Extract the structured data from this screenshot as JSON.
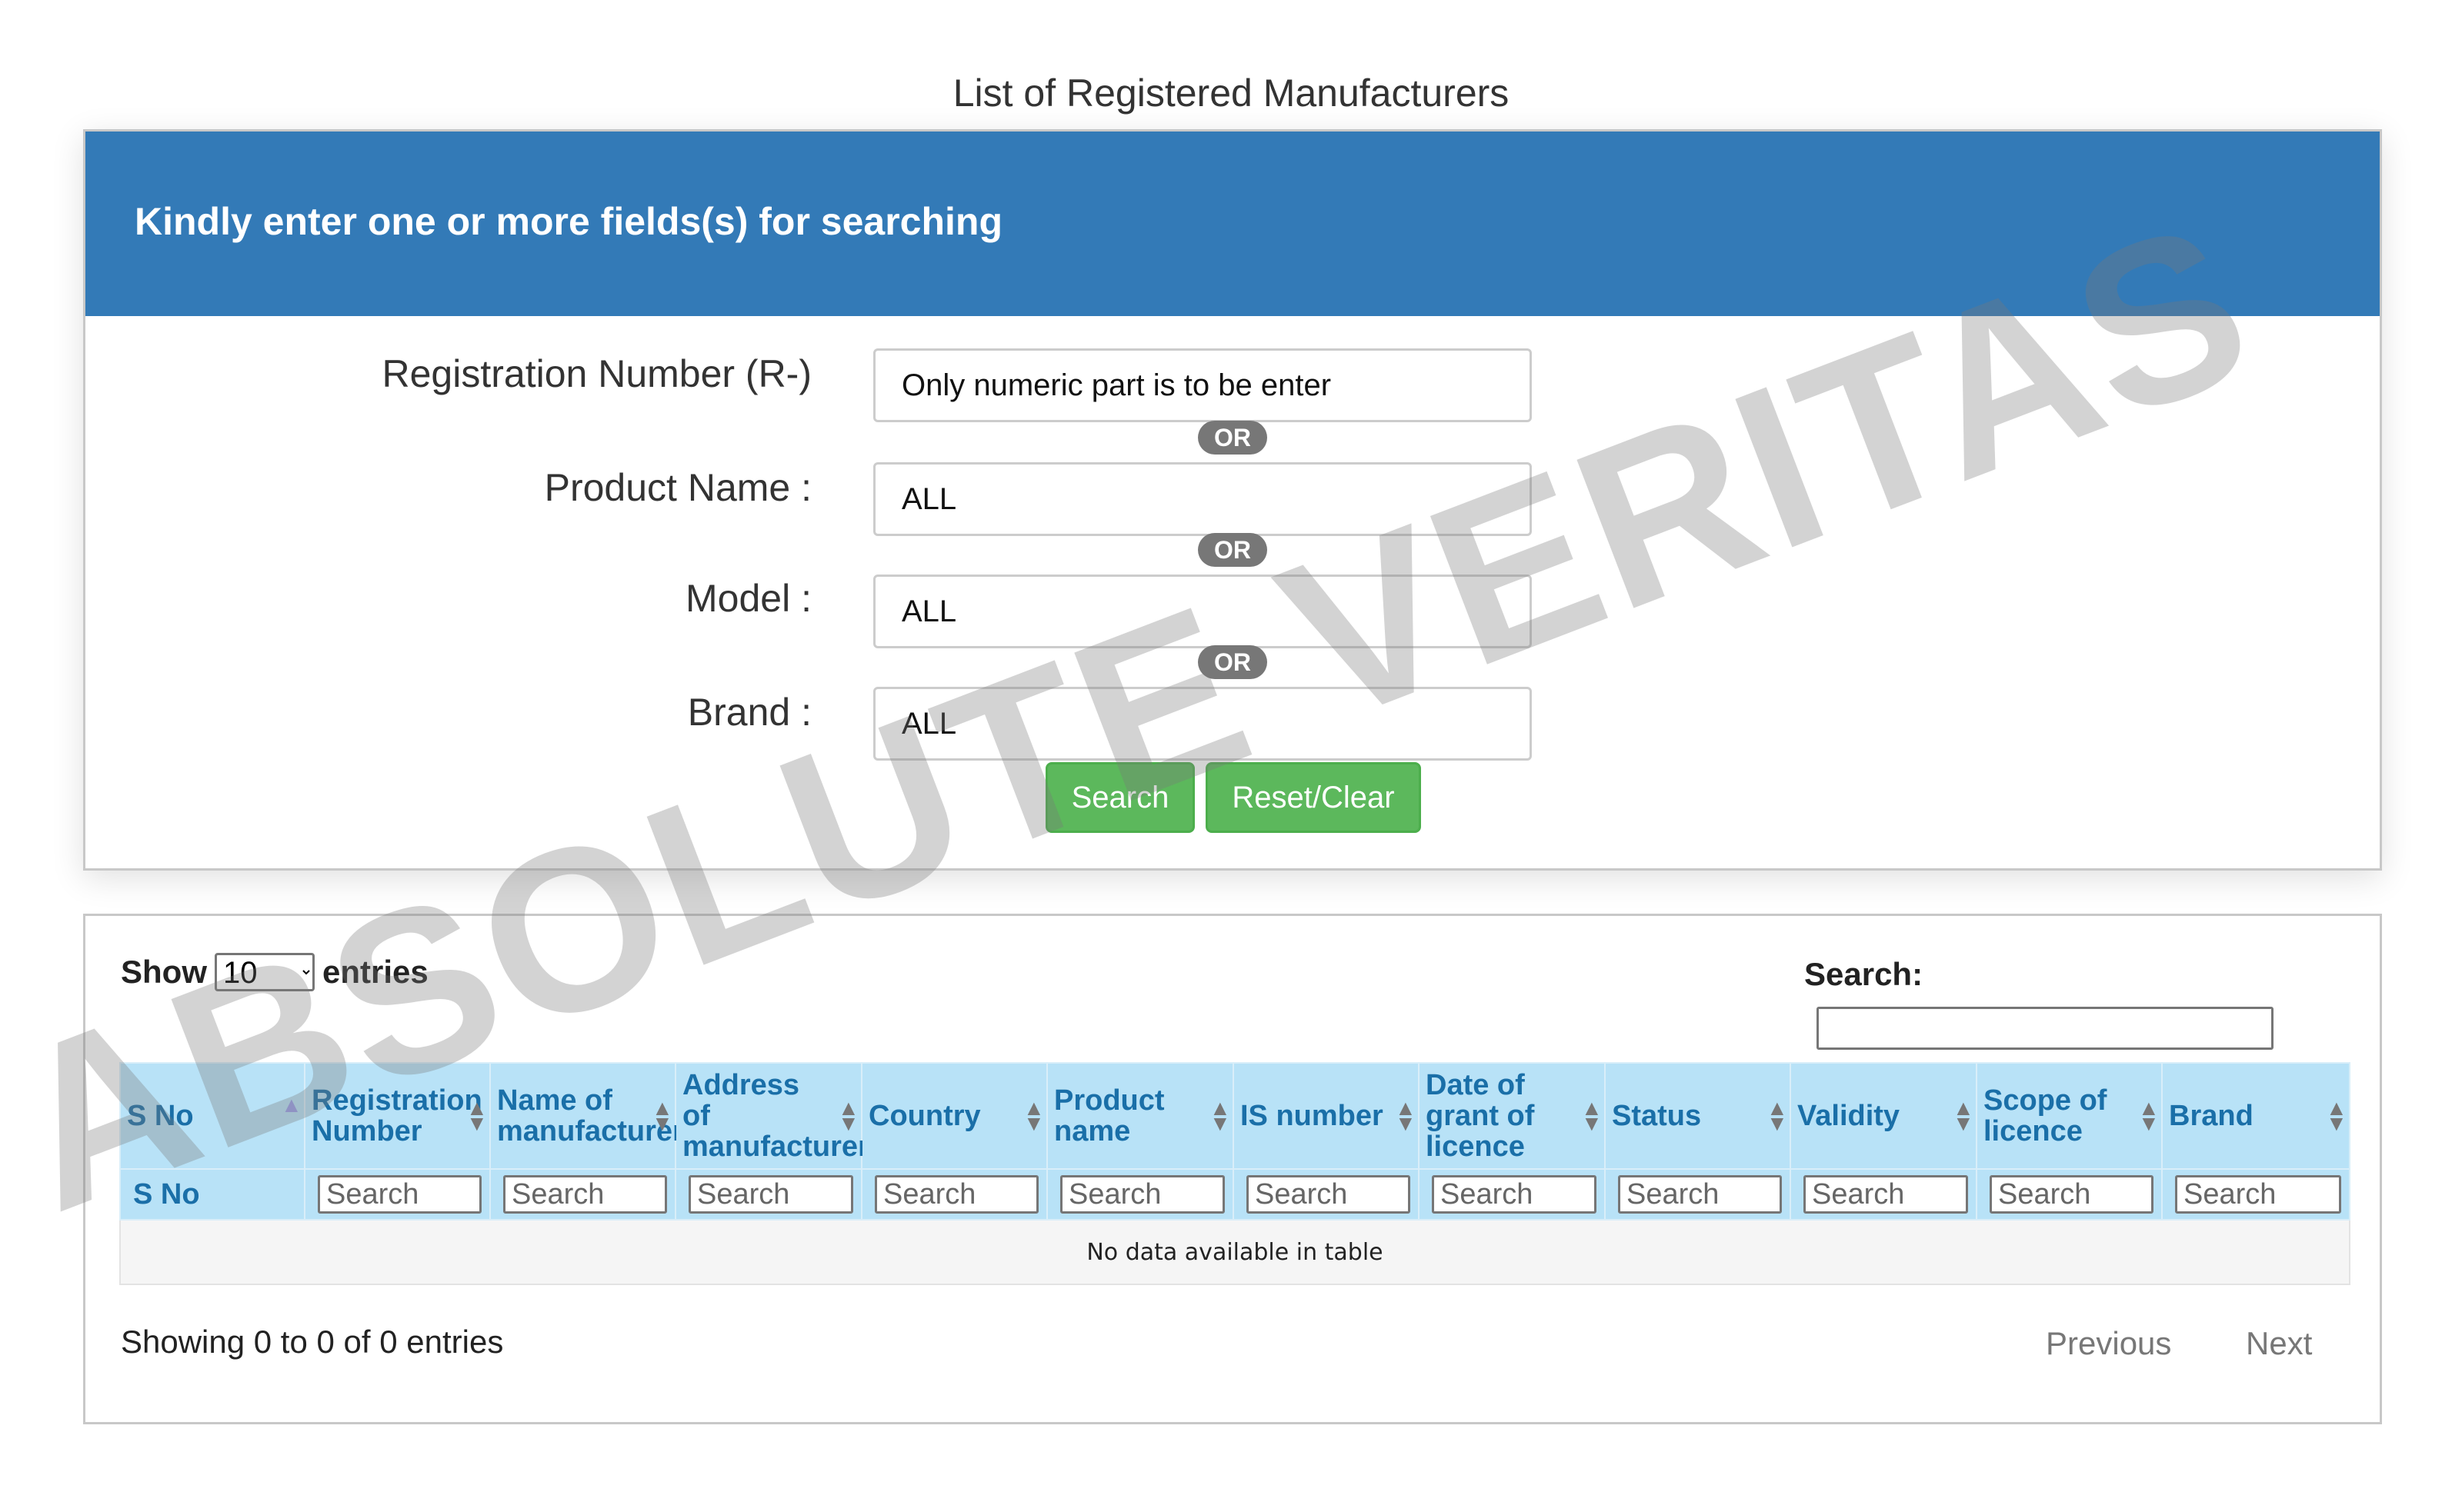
{
  "page": {
    "title": "List of Registered Manufacturers"
  },
  "search_panel": {
    "heading": "Kindly enter one or more fields(s) for searching",
    "fields": [
      {
        "label": "Registration Number (R-)",
        "placeholder": "Only numeric part is to be enter",
        "value": ""
      },
      {
        "label": "Product Name :",
        "value": "ALL"
      },
      {
        "label": "Model :",
        "value": "ALL"
      },
      {
        "label": "Brand :",
        "value": "ALL"
      }
    ],
    "or_label": "OR",
    "search_button": "Search",
    "reset_button": "Reset/Clear"
  },
  "table_panel": {
    "show_label": "Show",
    "entries_label": "entries",
    "page_length": "10",
    "search_label": "Search:",
    "columns": [
      "S No",
      "Registration Number",
      "Name of manufacturer",
      "Address of manufacturer",
      "Country",
      "Product name",
      "IS number",
      "Date of grant of licence",
      "Status",
      "Validity",
      "Scope of licence",
      "Brand"
    ],
    "filter_first_cell": "S No",
    "filter_placeholder": "Search",
    "empty_message": "No data available in table",
    "info": "Showing 0 to 0 of 0 entries",
    "previous": "Previous",
    "next": "Next"
  },
  "watermark": "ABSOLUTE VERITAS",
  "colors": {
    "header_blue": "#337ab7",
    "button_green": "#5cb85c",
    "table_header": "#b8e2f7"
  }
}
